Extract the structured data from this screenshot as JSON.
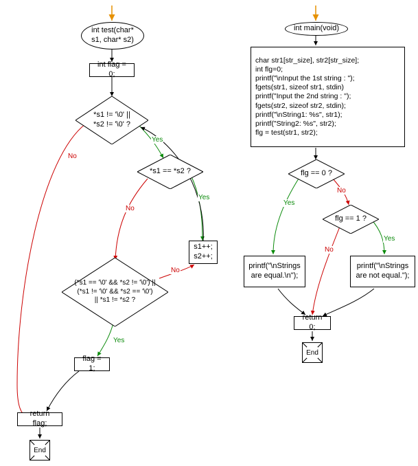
{
  "left": {
    "func_sig": "int test(char* s1, char* s2)",
    "init": "int flag = 0;",
    "cond_loop": "*s1 != '\\0' ||\n*s2 != '\\0' ?",
    "cond_eq": "*s1 == *s2 ?",
    "cond_big": "(*s1 == '\\0' && *s2 != '\\0') || (*s1 != '\\0' && *s2 == '\\0')\n|| *s1 != *s2 ?",
    "inc": "s1++;\ns2++;",
    "set_flag": "flag = 1;",
    "ret": "return flag;",
    "end": "End"
  },
  "right": {
    "func_sig": "int main(void)",
    "body": "char str1[str_size], str2[str_size];\nint flg=0;\nprintf(\"\\nInput the 1st string : \");\nfgets(str1, sizeof str1, stdin)\nprintf(\"Input the 2nd string : \");\nfgets(str2, sizeof str2, stdin);\nprintf(\"\\nString1: %s\", str1);\nprintf(\"String2: %s\", str2);\nflg = test(str1, str2);",
    "cond0": "flg == 0 ?",
    "cond1": "flg == 1 ?",
    "print_eq": "printf(\"\\nStrings are equal.\\n\");",
    "print_neq": "printf(\"\\nStrings are not equal.\");",
    "ret": "return 0;",
    "end": "End"
  },
  "labels": {
    "yes": "Yes",
    "no": "No"
  }
}
